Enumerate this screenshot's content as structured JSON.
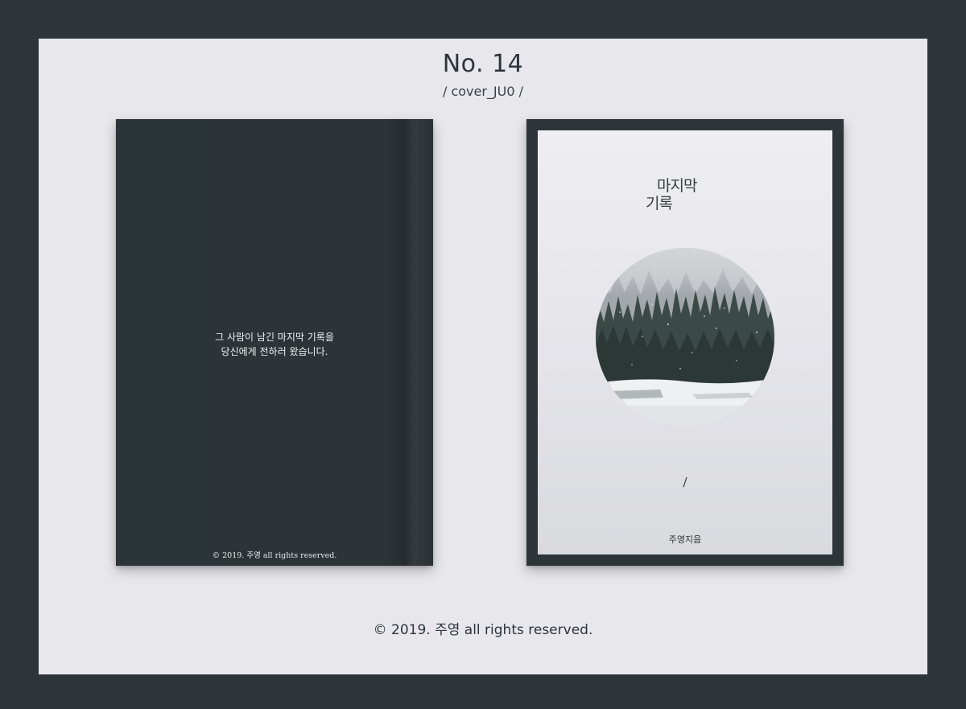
{
  "header": {
    "title": "No. 14",
    "subtitle": "/ cover_JU0 /"
  },
  "back_cover": {
    "line1": "그 사람이 남긴 마지막 기록을",
    "line2": "당신에게 전하러 왔습니다.",
    "copyright": "© 2019. 주영 all rights reserved."
  },
  "front_cover": {
    "title_line1": "마지막",
    "title_line2": "기록",
    "slash": "/",
    "author": "주영지음"
  },
  "footer": {
    "copyright": "© 2019. 주영 all rights reserved."
  },
  "colors": {
    "background": "#2d3539",
    "panel": "#e8e8ec",
    "cover_dark": "#2b3438",
    "cover_light": "#e6e6ea"
  }
}
